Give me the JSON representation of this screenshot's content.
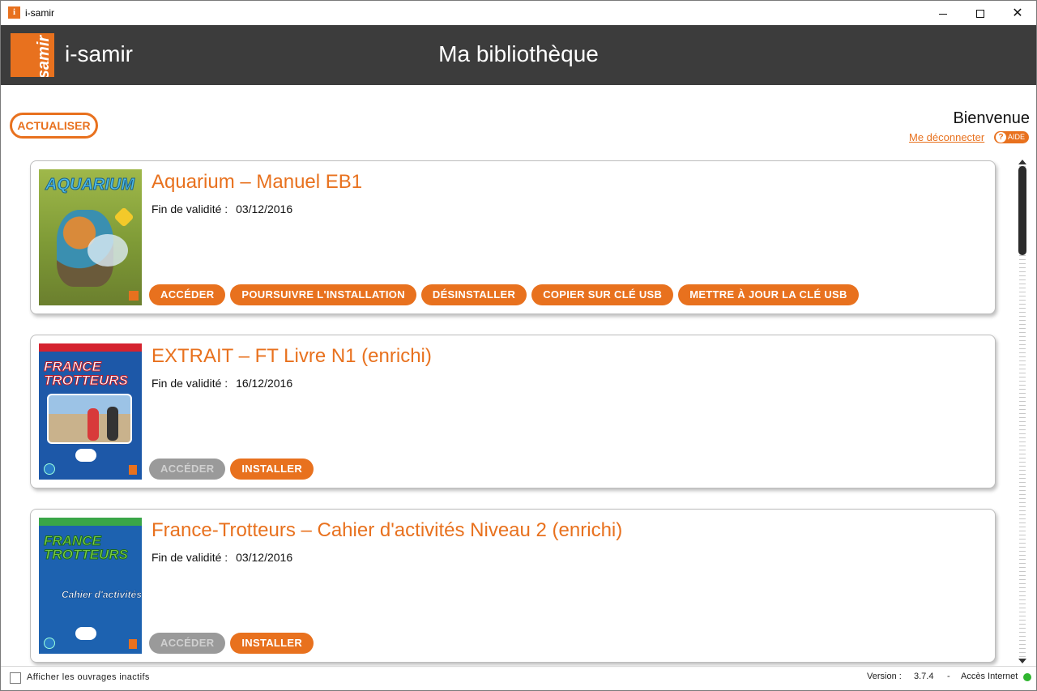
{
  "window": {
    "title": "i-samir"
  },
  "header": {
    "brand": "i-samir",
    "logo_text": "samir",
    "page_title": "Ma bibliothèque"
  },
  "toolbar": {
    "refresh_label": "ACTUALISER"
  },
  "user": {
    "welcome": "Bienvenue",
    "logout_label": "Me déconnecter",
    "help_label": "AIDE"
  },
  "books": [
    {
      "title": "Aquarium – Manuel EB1",
      "validity_label": "Fin de validité :",
      "validity_date": "03/12/2016",
      "cover_title": "AQUARIUM",
      "actions": [
        {
          "label": "ACCÉDER",
          "enabled": true
        },
        {
          "label": "POURSUIVRE L'INSTALLATION",
          "enabled": true
        },
        {
          "label": "DÉSINSTALLER",
          "enabled": true
        },
        {
          "label": "COPIER SUR CLÉ USB",
          "enabled": true
        },
        {
          "label": "METTRE À JOUR LA CLÉ USB",
          "enabled": true
        }
      ]
    },
    {
      "title": "EXTRAIT – FT Livre N1 (enrichi)",
      "validity_label": "Fin de validité :",
      "validity_date": "16/12/2016",
      "cover_title": "FRANCE TROTTEURS",
      "actions": [
        {
          "label": "ACCÉDER",
          "enabled": false
        },
        {
          "label": "INSTALLER",
          "enabled": true
        }
      ]
    },
    {
      "title": "France-Trotteurs – Cahier d'activités Niveau 2 (enrichi)",
      "validity_label": "Fin de validité :",
      "validity_date": "03/12/2016",
      "cover_title": "FRANCE TROTTEURS",
      "cover_subtitle": "Cahier d'activités",
      "actions": [
        {
          "label": "ACCÉDER",
          "enabled": false
        },
        {
          "label": "INSTALLER",
          "enabled": true
        }
      ]
    }
  ],
  "footer": {
    "inactive_label": "Afficher les ouvrages inactifs",
    "inactive_checked": false,
    "version_label": "Version :",
    "version_value": "3.7.4",
    "separator": "-",
    "internet_label": "Accès Internet",
    "internet_status_color": "#2fb52f"
  },
  "colors": {
    "accent": "#e8711e",
    "header_bg": "#3c3c3c",
    "disabled_btn": "#9a9a9a"
  }
}
